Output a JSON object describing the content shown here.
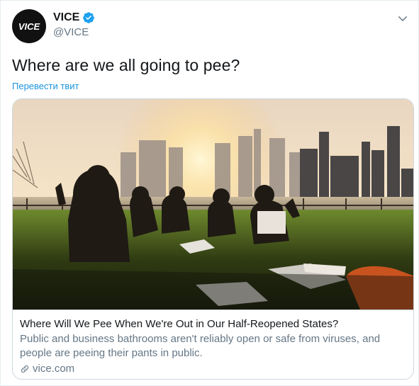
{
  "author": {
    "display_name": "VICE",
    "handle": "@VICE",
    "logo_text": "VICE"
  },
  "tweet": {
    "text": "Where are we all going to pee?",
    "translate_label": "Перевести твит"
  },
  "card": {
    "title": "Where Will We Pee When We're Out in Our Half-Reopened States?",
    "description": "Public and business bathrooms aren't reliably open or safe from viruses, and people are peeing their pants in public.",
    "domain": "vice.com"
  },
  "colors": {
    "link": "#1b95e0",
    "verified": "#1da1f2",
    "muted": "#657786",
    "text": "#14171a"
  },
  "icons": {
    "verified": "verified-badge-icon",
    "caret": "chevron-down-icon",
    "link": "link-icon"
  }
}
